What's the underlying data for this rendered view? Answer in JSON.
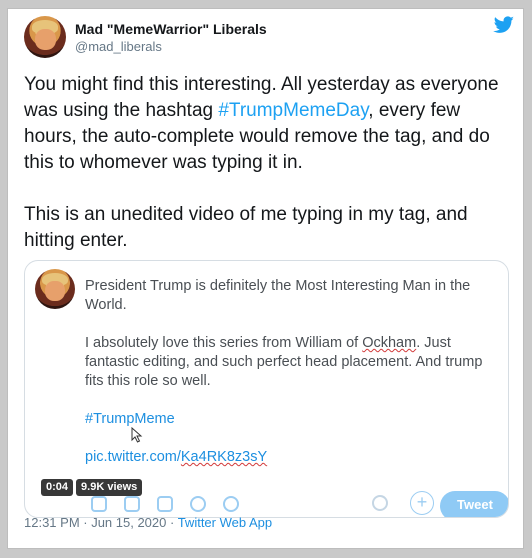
{
  "author": {
    "display_name": "Mad \"MemeWarrior\" Liberals",
    "handle": "@mad_liberals"
  },
  "tweet": {
    "line1_before": "You might find this interesting.  All yesterday as everyone was using the hashtag ",
    "hashtag": "#TrumpMemeDay",
    "line1_after": ", every few hours, the auto-complete would remove the tag, and do this to whomever was typing it in.",
    "paragraph2": "This is an unedited video of me typing in my tag, and hitting enter."
  },
  "media": {
    "text1": "President Trump is definitely the Most Interesting Man in the World.",
    "text2_before": "I absolutely love this series from William of ",
    "text2_misspelled": "Ockham",
    "text2_after": ".  Just fantastic editing, and such perfect head placement.  And trump fits this role so well.",
    "hashtag": "#TrumpMeme",
    "link_prefix": "pic.twitter.com/",
    "link_id": "Ka4RK8z3sY",
    "tweet_button": "Tweet",
    "add_symbol": "+",
    "video_time": "0:04",
    "video_views": "9.9K views"
  },
  "footer": {
    "timestamp": "12:31 PM · Jun 15, 2020 · ",
    "source": "Twitter Web App"
  },
  "colors": {
    "accent": "#1da1f2",
    "text": "#14171a",
    "muted": "#657786"
  },
  "icons": [
    "twitter-bird-icon",
    "image-icon",
    "gif-icon",
    "poll-icon",
    "emoji-icon",
    "schedule-icon",
    "cursor-icon"
  ]
}
